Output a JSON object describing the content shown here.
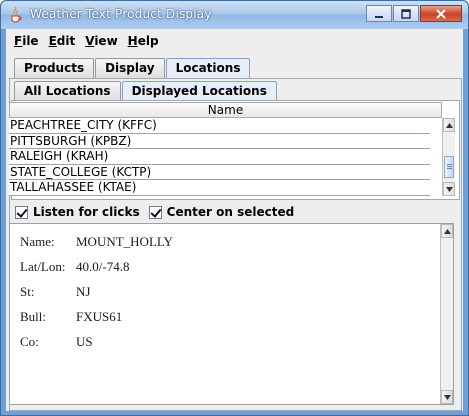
{
  "window": {
    "title": "Weather Text Product Display",
    "minimize_icon": "minimize-icon",
    "maximize_icon": "maximize-icon",
    "close_icon": "close-icon"
  },
  "menu": [
    {
      "label": "File",
      "mnemonic": "F",
      "rest": "ile"
    },
    {
      "label": "Edit",
      "mnemonic": "E",
      "rest": "dit"
    },
    {
      "label": "View",
      "mnemonic": "V",
      "rest": "iew"
    },
    {
      "label": "Help",
      "mnemonic": "H",
      "rest": "elp"
    }
  ],
  "main_tabs": [
    {
      "label": "Products",
      "active": false
    },
    {
      "label": "Display",
      "active": false
    },
    {
      "label": "Locations",
      "active": true
    }
  ],
  "sub_tabs": [
    {
      "label": "All Locations",
      "active": false
    },
    {
      "label": "Displayed Locations",
      "active": true
    }
  ],
  "table": {
    "header": "Name",
    "rows": [
      "PEACHTREE_CITY (KFFC)",
      "PITTSBURGH (KPBZ)",
      "RALEIGH (KRAH)",
      "STATE_COLLEGE (KCTP)",
      "TALLAHASSEE (KTAE)"
    ]
  },
  "options": {
    "listen_label": "Listen for clicks",
    "listen_checked": true,
    "center_label": "Center on selected",
    "center_checked": true
  },
  "details": [
    {
      "label": "Name:",
      "value": "MOUNT_HOLLY"
    },
    {
      "label": "Lat/Lon:",
      "value": "40.0/-74.8"
    },
    {
      "label": "St:",
      "value": "NJ"
    },
    {
      "label": "Bull:",
      "value": "FXUS61"
    },
    {
      "label": "Co:",
      "value": "US"
    }
  ]
}
